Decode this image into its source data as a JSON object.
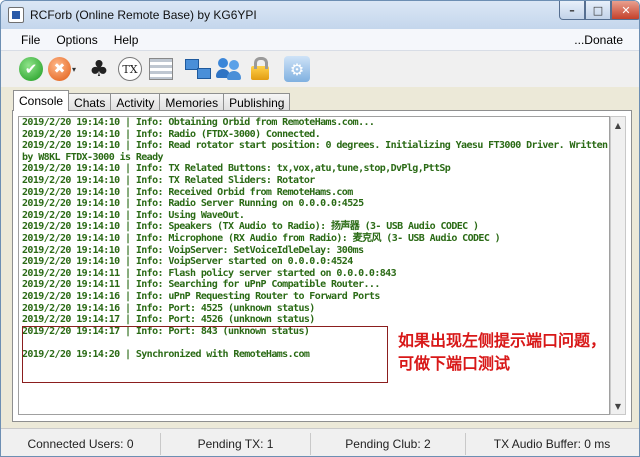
{
  "window": {
    "title": "RCForb (Online Remote Base) by KG6YPI",
    "controls": {
      "minimize": "–",
      "maximize": "□",
      "close": "✕"
    }
  },
  "menu": {
    "items": [
      "File",
      "Options",
      "Help"
    ],
    "donate": "...Donate"
  },
  "toolbar": {
    "icons": [
      "connect-icon",
      "disconnect-icon",
      "club-icon",
      "tx-icon",
      "list-icon",
      "network-icon",
      "users-icon",
      "lock-icon",
      "settings-icon"
    ]
  },
  "tabs": [
    "Console",
    "Chats",
    "Activity",
    "Memories",
    "Publishing"
  ],
  "console": {
    "lines": [
      "2019/2/20 19:14:10 | Info: Obtaining Orbid from RemoteHams.com...",
      "2019/2/20 19:14:10 | Info: Radio (FTDX-3000) Connected.",
      "2019/2/20 19:14:10 | Info: Read rotator start position: 0 degrees. Initializing Yaesu FT3000 Driver. Written by W8KL FTDX-3000 is Ready",
      "2019/2/20 19:14:10 | Info: TX Related Buttons: tx,vox,atu,tune,stop,DvPlg,PttSp",
      "2019/2/20 19:14:10 | Info: TX Related Sliders: Rotator",
      "2019/2/20 19:14:10 | Info: Received Orbid from RemoteHams.com",
      "2019/2/20 19:14:10 | Info: Radio Server Running on 0.0.0.0:4525",
      "2019/2/20 19:14:10 | Info: Using WaveOut.",
      "2019/2/20 19:14:10 | Info: Speakers (TX Audio to Radio): 扬声器 (3- USB Audio CODEC )",
      "2019/2/20 19:14:10 | Info: Microphone (RX Audio from Radio): 麦克风 (3- USB Audio CODEC )",
      "2019/2/20 19:14:10 | Info: VoipServer: SetVoiceIdleDelay: 300ms",
      "2019/2/20 19:14:10 | Info: VoipServer started on 0.0.0.0:4524",
      "2019/2/20 19:14:11 | Info: Flash policy server started on 0.0.0.0:843",
      "2019/2/20 19:14:11 | Info: Searching for uPnP Compatible Router...",
      "2019/2/20 19:14:16 | Info: uPnP Requesting Router to Forward Ports",
      "2019/2/20 19:14:16 | Info: Port: 4525 (unknown status)",
      "2019/2/20 19:14:17 | Info: Port: 4526 (unknown status)",
      "2019/2/20 19:14:17 | Info: Port: 843 (unknown status)",
      "",
      "2019/2/20 19:14:20 | Synchronized with RemoteHams.com"
    ]
  },
  "annotation": {
    "text": "如果出现左侧提示端口问题，可做下端口测试",
    "color": "#d81818"
  },
  "status": {
    "connected_users": "Connected Users: 0",
    "pending_tx": "Pending TX: 1",
    "pending_club": "Pending Club: 2",
    "tx_audio_buffer": "TX Audio Buffer: 0 ms"
  }
}
